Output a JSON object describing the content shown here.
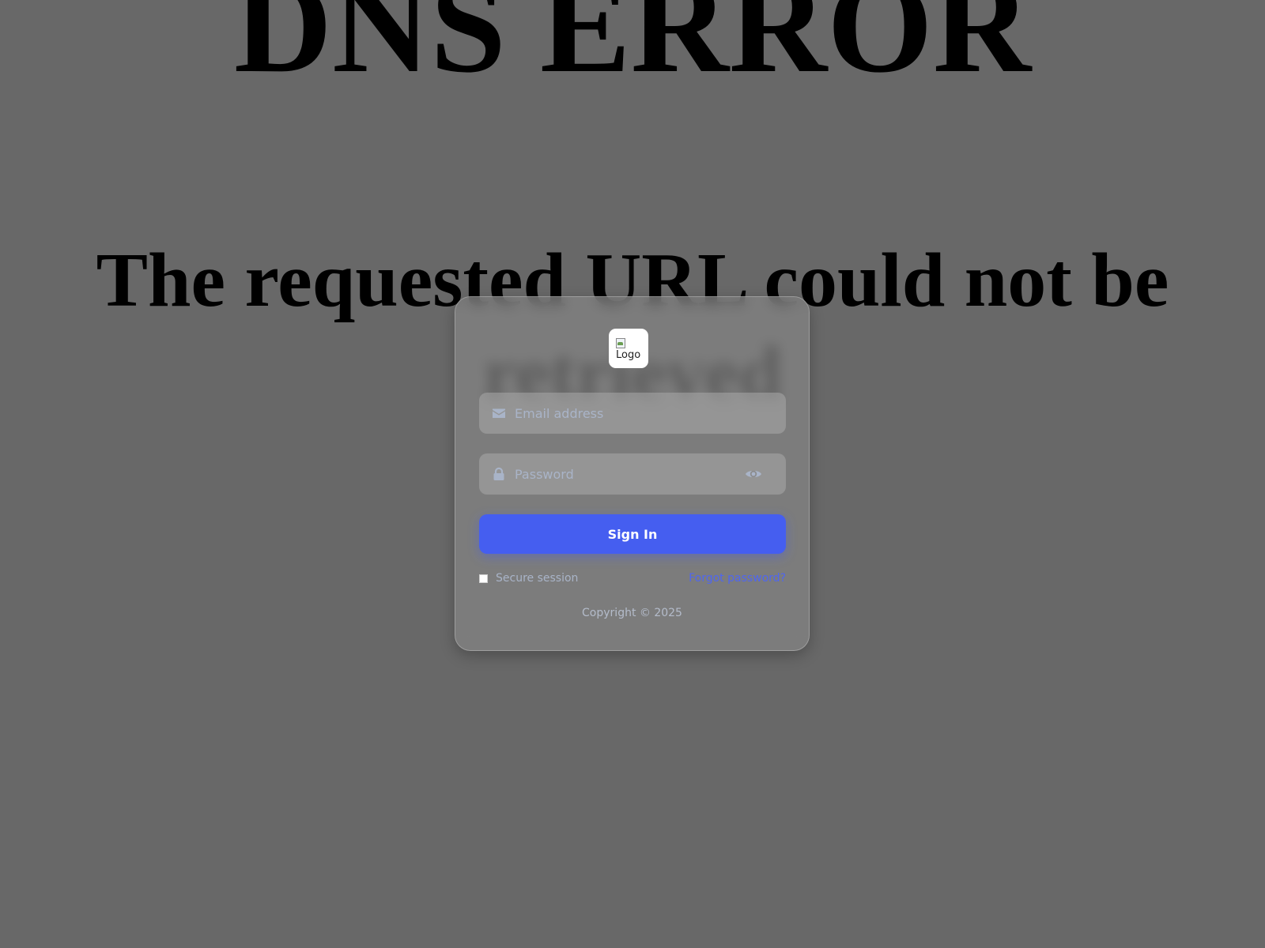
{
  "background": {
    "heading": "DNS ERROR",
    "message": "The requested URL could not be retrieved"
  },
  "login": {
    "logo_alt": "Logo",
    "email_placeholder": "Email address",
    "email_value": "",
    "password_placeholder": "Password",
    "password_value": "",
    "signin_label": "Sign In",
    "remember_label": "Secure session",
    "remember_checked": false,
    "forgot_label": "Forgot password?",
    "copyright": "Copyright © 2025"
  },
  "icons": {
    "email": "envelope-icon",
    "password": "lock-icon",
    "toggle": "eye-icon",
    "logo": "broken-image-icon"
  },
  "colors": {
    "page_background": "#686868",
    "accent": "#455ef0",
    "link": "#4f66f0",
    "placeholder": "#a9b4c8",
    "icon": "#a9b4c8"
  }
}
